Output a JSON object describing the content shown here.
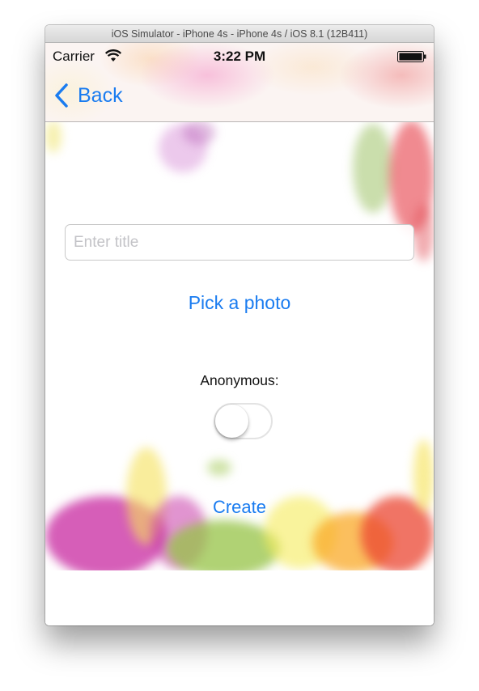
{
  "simulator": {
    "title": "iOS Simulator - iPhone 4s - iPhone 4s / iOS 8.1 (12B411)"
  },
  "status_bar": {
    "carrier": "Carrier",
    "time": "3:22 PM",
    "wifi_icon": "wifi-icon",
    "battery_icon": "battery-icon"
  },
  "nav": {
    "back_label": "Back",
    "back_icon": "chevron-left-icon"
  },
  "form": {
    "title_placeholder": "Enter title",
    "title_value": "",
    "pick_photo_label": "Pick a photo",
    "anonymous_label": "Anonymous:",
    "anonymous_on": false,
    "create_label": "Create"
  },
  "colors": {
    "accent": "#1a7cf0",
    "toggle_border": "#e3e3e3"
  }
}
